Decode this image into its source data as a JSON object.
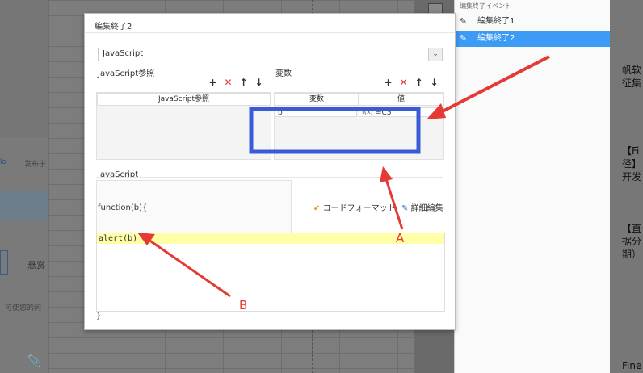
{
  "left_page": {
    "fragments": [
      "lo",
      "发布于",
      "悬赏",
      "可使您的问"
    ]
  },
  "right_page": {
    "lines": [
      "帆软",
      "征集",
      "【Fi",
      "径】",
      "开发",
      "【直",
      "据分",
      "期）",
      "Fine"
    ]
  },
  "event_panel": {
    "header": "编集終了イベント",
    "items": [
      {
        "label": "編集終了1",
        "selected": false
      },
      {
        "label": "編集終了2",
        "selected": true
      }
    ],
    "selected_color": "#3b9bf5"
  },
  "dialog": {
    "title": "編集終了2",
    "language": "JavaScript",
    "js_ref": {
      "label": "JavaScript参照",
      "column": "JavaScript参照",
      "toolbar": [
        "+",
        "✕",
        "↑",
        "↓"
      ]
    },
    "variables": {
      "label": "変数",
      "columns": [
        "変数",
        "値"
      ],
      "rows": [
        {
          "name": "b",
          "value": "=C5"
        }
      ],
      "toolbar": [
        "+",
        "✕",
        "↑",
        "↓"
      ]
    },
    "js_section_label": "JavaScript",
    "function_header": "function(b){",
    "code_format_label": "コードフォーマット",
    "detail_edit_label": "詳細編集",
    "code_line": "alert(b)",
    "closing_brace": "}"
  },
  "annotations": {
    "a": "A",
    "b": "B",
    "color": "#e53935",
    "box_color": "#3b5bd6"
  }
}
